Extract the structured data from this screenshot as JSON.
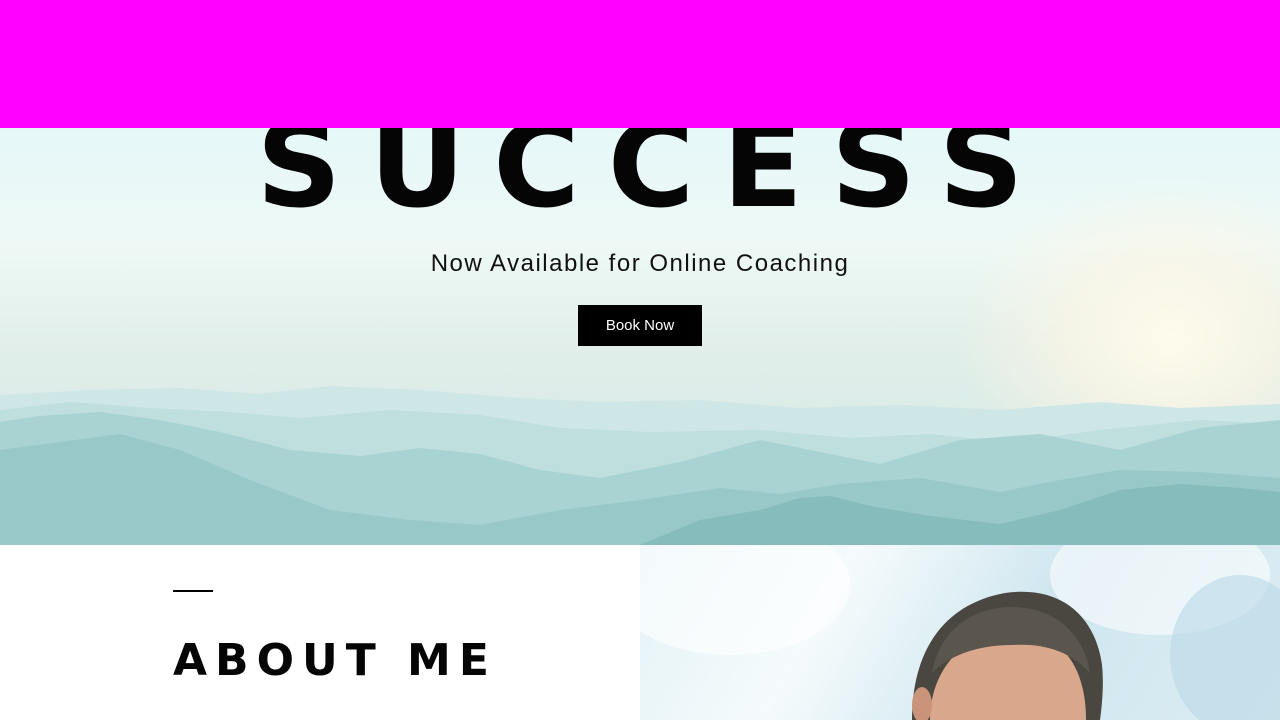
{
  "header": {
    "background_color": "#ff00ff"
  },
  "hero": {
    "title": "SUCCESS",
    "subtitle": "Now Available for Online Coaching",
    "cta_label": "Book Now"
  },
  "about": {
    "title": "ABOUT ME"
  },
  "colors": {
    "text": "#050505",
    "button_bg": "#000000",
    "button_text": "#ffffff"
  }
}
